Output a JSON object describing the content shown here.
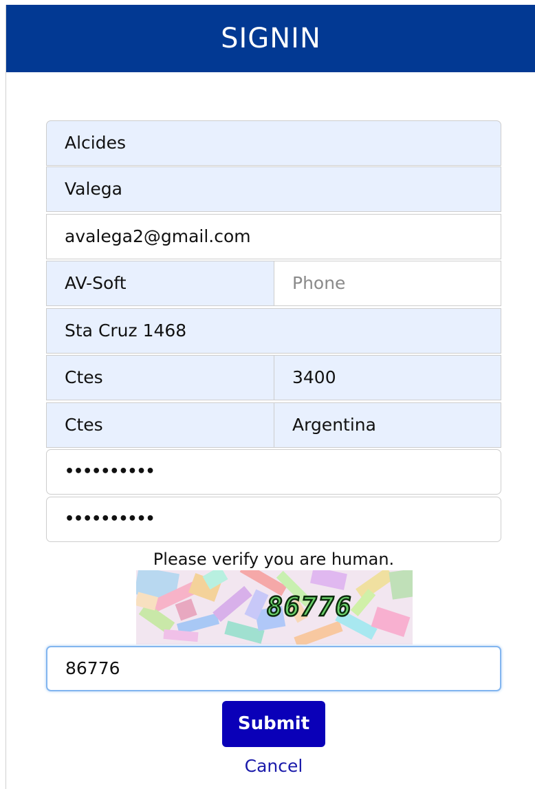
{
  "header": {
    "title": "SIGNIN"
  },
  "form": {
    "first_name": "Alcides",
    "last_name": "Valega",
    "email": "avalega2@gmail.com",
    "company": "AV-Soft",
    "phone_placeholder": "Phone",
    "address": "Sta Cruz 1468",
    "city": "Ctes",
    "zip": "3400",
    "state": "Ctes",
    "country": "Argentina",
    "password": "••••••••••",
    "confirm_password": "••••••••••"
  },
  "captcha": {
    "prompt": "Please verify you are human.",
    "image_code": "86776",
    "input_value": "86776"
  },
  "actions": {
    "submit_label": "Submit",
    "cancel_label": "Cancel"
  },
  "colors": {
    "header_bg": "#023993",
    "autofill_bg": "#e8f0fe",
    "submit_bg": "#0a00b8",
    "link": "#1a1aaa"
  }
}
